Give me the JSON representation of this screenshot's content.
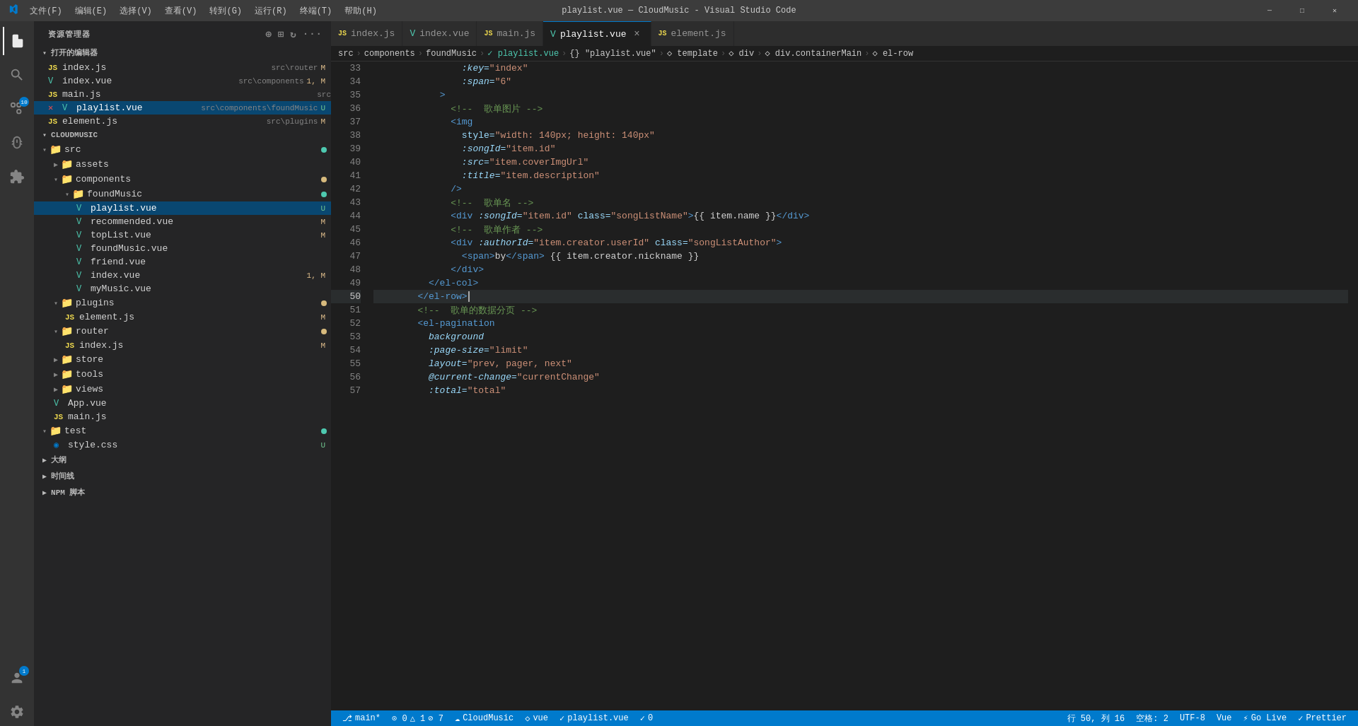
{
  "titleBar": {
    "title": "playlist.vue — CloudMusic - Visual Studio Code",
    "menuItems": [
      "文件(F)",
      "编辑(E)",
      "选择(V)",
      "查看(V)",
      "转到(G)",
      "运行(R)",
      "终端(T)",
      "帮助(H)"
    ],
    "windowButtons": [
      "—",
      "□",
      "✕"
    ]
  },
  "sidebar": {
    "header": "资源管理器",
    "sections": {
      "openEditors": "打开的编辑器",
      "cloudmusic": "CLOUDMUSIC"
    }
  },
  "openEditors": [
    {
      "name": "index.js",
      "path": "src\\router",
      "lang": "js",
      "badge": "M",
      "badgeColor": "M"
    },
    {
      "name": "index.vue",
      "path": "src\\components",
      "lang": "vue",
      "badge": "1, M",
      "badgeColor": "M"
    },
    {
      "name": "main.js",
      "path": "src",
      "lang": "js",
      "badge": "",
      "badgeColor": ""
    },
    {
      "name": "playlist.vue",
      "path": "src\\components\\foundMusic",
      "lang": "vue",
      "badge": "U",
      "badgeColor": "U",
      "active": true,
      "modified": true
    },
    {
      "name": "element.js",
      "path": "src\\plugins",
      "lang": "js",
      "badge": "M",
      "badgeColor": "M"
    }
  ],
  "tabs": [
    {
      "name": "index.js",
      "lang": "js",
      "active": false
    },
    {
      "name": "index.vue",
      "lang": "vue",
      "active": false
    },
    {
      "name": "main.js",
      "lang": "js",
      "active": false
    },
    {
      "name": "playlist.vue",
      "lang": "vue",
      "active": true,
      "showClose": true
    },
    {
      "name": "element.js",
      "lang": "js",
      "active": false
    }
  ],
  "breadcrumb": [
    "src",
    ">",
    "components",
    ">",
    "foundMusic",
    ">",
    "✓ playlist.vue",
    ">",
    "{} \"playlist.vue\"",
    ">",
    "◇ template",
    ">",
    "◇ div",
    ">",
    "◇ div.containerMain",
    ">",
    "◇ el-row"
  ],
  "codeLines": [
    {
      "num": 33,
      "content": "                :key=\"index\"",
      "tokens": [
        {
          "text": "                :key=",
          "class": "tok-attr-italic"
        },
        {
          "text": "\"index\"",
          "class": "tok-string"
        }
      ]
    },
    {
      "num": 34,
      "content": "                :span=\"6\"",
      "tokens": [
        {
          "text": "                :span=",
          "class": "tok-attr-italic"
        },
        {
          "text": "\"6\"",
          "class": "tok-string"
        }
      ]
    },
    {
      "num": 35,
      "content": "            >",
      "tokens": [
        {
          "text": "            ",
          "class": "tok-text"
        },
        {
          "text": ">",
          "class": "tok-tag"
        }
      ]
    },
    {
      "num": 36,
      "content": "              <!-- 歌单图片 -->",
      "tokens": [
        {
          "text": "              <!-- 歌单图片 -->",
          "class": "tok-comment"
        }
      ]
    },
    {
      "num": 37,
      "content": "              <img",
      "tokens": [
        {
          "text": "              ",
          "class": "tok-text"
        },
        {
          "text": "<img",
          "class": "tok-tag"
        }
      ]
    },
    {
      "num": 38,
      "content": "                style=\"width: 140px; height: 140px\"",
      "tokens": [
        {
          "text": "                ",
          "class": "tok-text"
        },
        {
          "text": "style=",
          "class": "tok-attr"
        },
        {
          "text": "\"width: 140px; height: 140px\"",
          "class": "tok-string"
        }
      ]
    },
    {
      "num": 39,
      "content": "                :songId=\"item.id\"",
      "tokens": [
        {
          "text": "                ",
          "class": "tok-text"
        },
        {
          "text": ":songId=",
          "class": "tok-attr-italic"
        },
        {
          "text": "\"item.id\"",
          "class": "tok-string"
        }
      ]
    },
    {
      "num": 40,
      "content": "                :src=\"item.coverImgUrl\"",
      "tokens": [
        {
          "text": "                ",
          "class": "tok-text"
        },
        {
          "text": ":src=",
          "class": "tok-attr-italic"
        },
        {
          "text": "\"item.coverImgUrl\"",
          "class": "tok-string"
        }
      ]
    },
    {
      "num": 41,
      "content": "                :title=\"item.description\"",
      "tokens": [
        {
          "text": "                ",
          "class": "tok-text"
        },
        {
          "text": ":title=",
          "class": "tok-attr-italic"
        },
        {
          "text": "\"item.description\"",
          "class": "tok-string"
        }
      ]
    },
    {
      "num": 42,
      "content": "              />",
      "tokens": [
        {
          "text": "              ",
          "class": "tok-text"
        },
        {
          "text": "/>",
          "class": "tok-tag"
        }
      ]
    },
    {
      "num": 43,
      "content": "              <!-- 歌单名 -->",
      "tokens": [
        {
          "text": "              <!-- 歌单名 -->",
          "class": "tok-comment"
        }
      ]
    },
    {
      "num": 44,
      "content": "              <div :songId=\"item.id\" class=\"songListName\">{{ item.name }}</div>",
      "tokens": [
        {
          "text": "              ",
          "class": "tok-text"
        },
        {
          "text": "<div",
          "class": "tok-tag"
        },
        {
          "text": " :songId=",
          "class": "tok-attr-italic"
        },
        {
          "text": "\"item.id\"",
          "class": "tok-string"
        },
        {
          "text": " ",
          "class": "tok-text"
        },
        {
          "text": "class=",
          "class": "tok-attr"
        },
        {
          "text": "\"songListName\"",
          "class": "tok-string"
        },
        {
          "text": ">",
          "class": "tok-tag"
        },
        {
          "text": "{{ item.name }}",
          "class": "tok-text"
        },
        {
          "text": "</div>",
          "class": "tok-tag"
        }
      ]
    },
    {
      "num": 45,
      "content": "              <!-- 歌单作者 -->",
      "tokens": [
        {
          "text": "              <!-- 歌单作者 -->",
          "class": "tok-comment"
        }
      ]
    },
    {
      "num": 46,
      "content": "              <div :authorId=\"item.creator.userId\" class=\"songListAuthor\">",
      "tokens": [
        {
          "text": "              ",
          "class": "tok-text"
        },
        {
          "text": "<div",
          "class": "tok-tag"
        },
        {
          "text": " :authorId=",
          "class": "tok-attr-italic"
        },
        {
          "text": "\"item.creator.userId\"",
          "class": "tok-string"
        },
        {
          "text": " ",
          "class": "tok-text"
        },
        {
          "text": "class=",
          "class": "tok-attr"
        },
        {
          "text": "\"songListAuthor\"",
          "class": "tok-string"
        },
        {
          "text": ">",
          "class": "tok-tag"
        }
      ]
    },
    {
      "num": 47,
      "content": "                <span>by</span> {{ item.creator.nickname }}",
      "tokens": [
        {
          "text": "                ",
          "class": "tok-text"
        },
        {
          "text": "<span>",
          "class": "tok-tag"
        },
        {
          "text": "by",
          "class": "tok-text"
        },
        {
          "text": "</span>",
          "class": "tok-tag"
        },
        {
          "text": " {{ item.creator.nickname }}",
          "class": "tok-text"
        }
      ]
    },
    {
      "num": 48,
      "content": "              </div>",
      "tokens": [
        {
          "text": "              ",
          "class": "tok-text"
        },
        {
          "text": "</div>",
          "class": "tok-tag"
        }
      ]
    },
    {
      "num": 49,
      "content": "          </el-col>",
      "tokens": [
        {
          "text": "          ",
          "class": "tok-text"
        },
        {
          "text": "</el-col>",
          "class": "tok-tag"
        }
      ]
    },
    {
      "num": 50,
      "content": "        </el-row>",
      "tokens": [
        {
          "text": "        ",
          "class": "tok-text"
        },
        {
          "text": "</el-row>",
          "class": "tok-tag"
        }
      ],
      "active": true
    },
    {
      "num": 51,
      "content": "        <!-- 歌单的数据分页 -->",
      "tokens": [
        {
          "text": "        <!-- 歌单的数据分页 -->",
          "class": "tok-comment"
        }
      ]
    },
    {
      "num": 52,
      "content": "        <el-pagination",
      "tokens": [
        {
          "text": "        ",
          "class": "tok-text"
        },
        {
          "text": "<el-pagination",
          "class": "tok-tag"
        }
      ]
    },
    {
      "num": 53,
      "content": "          background",
      "tokens": [
        {
          "text": "          ",
          "class": "tok-text"
        },
        {
          "text": "background",
          "class": "tok-attr-italic"
        }
      ]
    },
    {
      "num": 54,
      "content": "          :page-size=\"limit\"",
      "tokens": [
        {
          "text": "          ",
          "class": "tok-text"
        },
        {
          "text": ":page-size=",
          "class": "tok-attr-italic"
        },
        {
          "text": "\"limit\"",
          "class": "tok-string"
        }
      ]
    },
    {
      "num": 55,
      "content": "          layout=\"prev, pager, next\"",
      "tokens": [
        {
          "text": "          ",
          "class": "tok-text"
        },
        {
          "text": "layout=",
          "class": "tok-attr-italic"
        },
        {
          "text": "\"prev, pager, next\"",
          "class": "tok-string"
        }
      ]
    },
    {
      "num": 56,
      "content": "          @current-change=\"currentChange\"",
      "tokens": [
        {
          "text": "          ",
          "class": "tok-text"
        },
        {
          "text": "@current-change=",
          "class": "tok-attr-italic"
        },
        {
          "text": "\"currentChange\"",
          "class": "tok-string"
        }
      ]
    },
    {
      "num": 57,
      "content": "          :total=\"total\"",
      "tokens": [
        {
          "text": "          ",
          "class": "tok-text"
        },
        {
          "text": ":total=",
          "class": "tok-attr-italic"
        },
        {
          "text": "\"total\"",
          "class": "tok-string"
        }
      ]
    }
  ],
  "statusBar": {
    "left": [
      {
        "text": "⎇ main*",
        "icon": "git-branch"
      },
      {
        "text": "⊙ 0  △ 1  ⊘ 7",
        "icon": "sync"
      },
      {
        "text": "☁ CloudMusic",
        "icon": "cloud"
      },
      {
        "text": "◇ vue",
        "icon": "vue"
      },
      {
        "text": "✓ playlist.vue",
        "icon": "check"
      },
      {
        "text": "✓ 0",
        "icon": "check"
      }
    ],
    "right": [
      {
        "text": "行 50, 列 16"
      },
      {
        "text": "空格: 2"
      },
      {
        "text": "UTF-8"
      },
      {
        "text": "Vue"
      },
      {
        "text": "⚡ Go Live"
      },
      {
        "text": "✓ Prettier"
      }
    ]
  },
  "fileTree": {
    "src": {
      "expanded": true,
      "children": {
        "assets": {
          "type": "folder",
          "expanded": false
        },
        "components": {
          "type": "folder",
          "expanded": true,
          "dot": "orange",
          "children": {
            "foundMusic": {
              "type": "folder",
              "expanded": true,
              "dot": "green",
              "children": {
                "playlist.vue": {
                  "type": "vue",
                  "badge": "U",
                  "active": true
                },
                "recommended.vue": {
                  "type": "vue",
                  "badge": "M"
                },
                "topList.vue": {
                  "type": "vue",
                  "badge": "M"
                },
                "foundMusic.vue": {
                  "type": "vue"
                },
                "friend.vue": {
                  "type": "vue"
                },
                "index.vue": {
                  "type": "vue",
                  "badge": "1, M"
                },
                "myMusic.vue": {
                  "type": "vue"
                }
              }
            }
          }
        },
        "plugins": {
          "type": "folder",
          "expanded": true,
          "dot": "orange",
          "children": {
            "element.js": {
              "type": "js",
              "badge": "M"
            }
          }
        },
        "router": {
          "type": "folder",
          "expanded": true,
          "dot": "orange",
          "children": {
            "index.js": {
              "type": "js",
              "badge": "M"
            }
          }
        },
        "store": {
          "type": "folder",
          "expanded": false
        },
        "tools": {
          "type": "folder",
          "expanded": false
        },
        "views": {
          "type": "folder",
          "expanded": false
        },
        "App.vue": {
          "type": "vue"
        },
        "main.js": {
          "type": "js"
        }
      }
    },
    "test": {
      "expanded": true,
      "dot": "green",
      "children": {
        "style.css": {
          "type": "css",
          "badge": "U"
        }
      }
    }
  }
}
